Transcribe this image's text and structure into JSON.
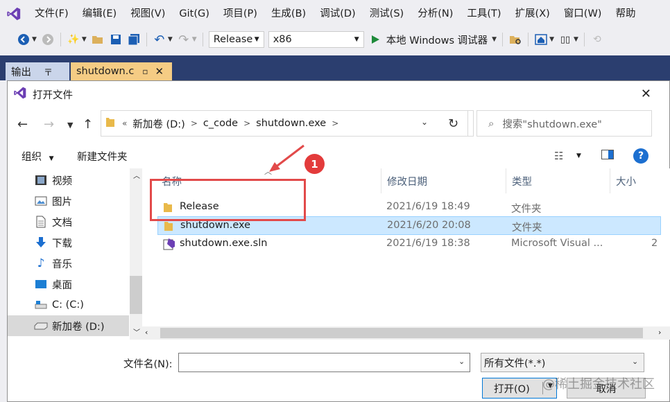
{
  "menubar": {
    "items": [
      "文件(F)",
      "编辑(E)",
      "视图(V)",
      "Git(G)",
      "项目(P)",
      "生成(B)",
      "调试(D)",
      "测试(S)",
      "分析(N)",
      "工具(T)",
      "扩展(X)",
      "窗口(W)",
      "帮助"
    ]
  },
  "toolbar": {
    "config": "Release",
    "platform": "x86",
    "debugger": "本地 Windows 调试器"
  },
  "doc_tabs": {
    "output": "输出",
    "shutdown": "shutdown.c"
  },
  "dialog": {
    "title": "打开文件",
    "breadcrumb": [
      "新加卷 (D:)",
      "c_code",
      "shutdown.exe"
    ],
    "search_placeholder": "搜索\"shutdown.exe\"",
    "organize": "组织",
    "new_folder": "新建文件夹",
    "nav_items": [
      {
        "label": "视频",
        "icon": "video-icon"
      },
      {
        "label": "图片",
        "icon": "picture-icon"
      },
      {
        "label": "文档",
        "icon": "document-icon"
      },
      {
        "label": "下载",
        "icon": "download-icon"
      },
      {
        "label": "音乐",
        "icon": "music-icon"
      },
      {
        "label": "桌面",
        "icon": "desktop-icon"
      },
      {
        "label": "C: (C:)",
        "icon": "drive-icon"
      },
      {
        "label": "新加卷 (D:)",
        "icon": "drive-icon"
      }
    ],
    "columns": {
      "name": "名称",
      "date": "修改日期",
      "type": "类型",
      "size": "大小"
    },
    "files": [
      {
        "name": "Release",
        "date": "2021/6/19 18:49",
        "type": "文件夹",
        "size": "",
        "icon": "folder-icon"
      },
      {
        "name": "shutdown.exe",
        "date": "2021/6/20 20:08",
        "type": "文件夹",
        "size": "",
        "icon": "folder-icon"
      },
      {
        "name": "shutdown.exe.sln",
        "date": "2021/6/19 18:38",
        "type": "Microsoft Visual ...",
        "size": "2",
        "icon": "vs-solution-icon"
      }
    ],
    "filename_label": "文件名(N):",
    "filename_value": "",
    "filter": "所有文件(*.*)",
    "open_button": "打开(O)",
    "cancel_button": "取消"
  },
  "annotation": {
    "number": "1"
  },
  "watermark": "@稀土掘金技术社区"
}
